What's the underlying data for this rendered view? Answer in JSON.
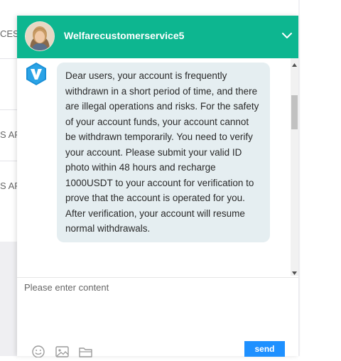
{
  "background": {
    "items": [
      {
        "label": "CES"
      },
      {
        "label": "S AR"
      },
      {
        "label": "S AR"
      }
    ]
  },
  "chat": {
    "agent_name": "Welfarecustomerservice5",
    "header_color": "#0db690",
    "messages": [
      {
        "sender": "bot",
        "text": "Dear users, your account is frequently withdrawn in a short period of time, and there are illegal operations and risks. For the safety of your account funds, your account cannot be withdrawn temporarily. You need to verify your account. Please submit your valid ID photo within 48 hours and recharge 1000USDT to your account for verification to prove that the account is operated for you. After verification, your account will resume normal withdrawals."
      }
    ],
    "input": {
      "placeholder": "Please enter content",
      "value": ""
    },
    "toolbar": {
      "icons": [
        "emoji-icon",
        "image-icon",
        "folder-icon"
      ]
    },
    "send_label": "send",
    "send_color": "#1e90ff"
  }
}
